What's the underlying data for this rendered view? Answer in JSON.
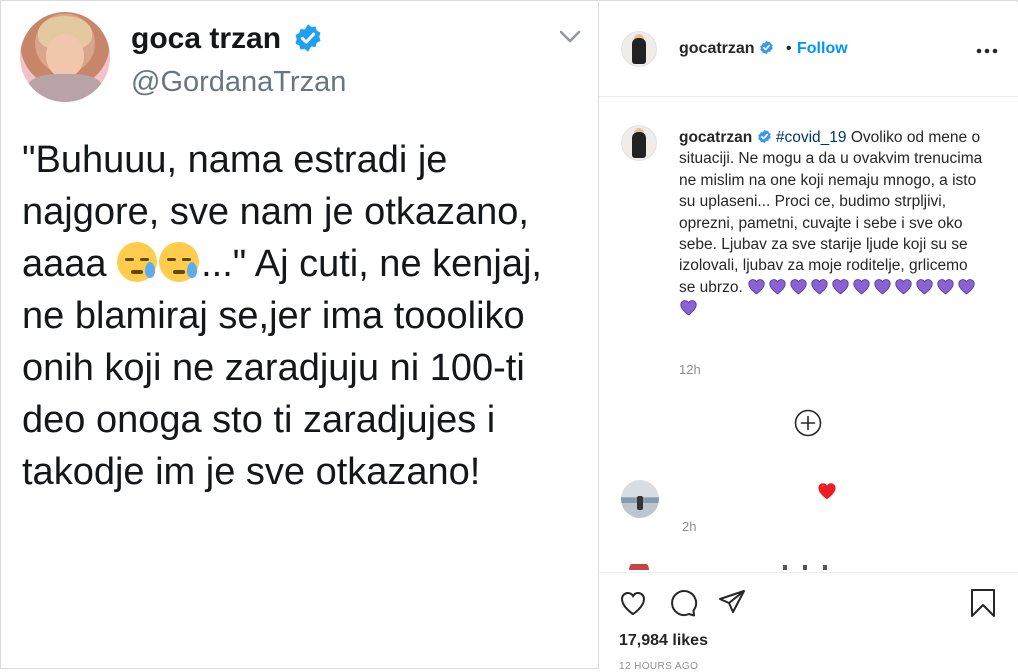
{
  "tweet": {
    "display_name": "goca trzan",
    "handle": "@GordanaTrzan",
    "text_before_emoji": "\"Buhuuu, nama estradi je najgore, sve nam je otkazano, aaaa ",
    "text_after_emoji": "...\" Aj cuti, ne kenjaj, ne blamiraj se,jer ima toooliko onih koji ne zaradjuju ni 100-ti deo onoga sto ti zaradjujes i takodje im je sve otkazano!",
    "emoji_name": "sad-tear-face-emoji",
    "menu_icon": "chevron-down-icon",
    "verified_icon": "verified-badge-icon"
  },
  "instagram": {
    "username": "gocatrzan",
    "follow_label": "Follow",
    "dot": "•",
    "more_icon": "more-horizontal-icon",
    "caption_hashtag": "#covid_19",
    "caption_text": " Ovoliko od mene o situaciji. Ne mogu a da u ovakvim trenucima ne mislim na one koji nemaju mnogo, a isto su uplaseni... Proci ce, budimo strpljivi, oprezni, pametni, cuvajte i sebe i sve oko sebe. Ljubav za sve starije ljude koji su se izolovali, ljubav za moje roditelje, grlicemo se ubrzo. ",
    "caption_heart_count": 12,
    "caption_heart_color": "#8a63d2",
    "caption_time": "12h",
    "load_more_icon": "plus-circle-icon",
    "comment_time": "2h",
    "comment_heart_color": "#ed4956",
    "likes": "17,984 likes",
    "timestamp": "12 HOURS AGO",
    "link_color": "#0095f6"
  }
}
